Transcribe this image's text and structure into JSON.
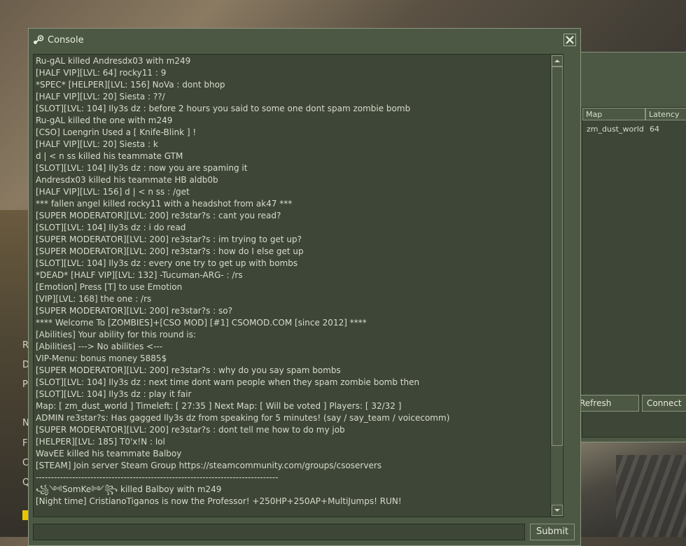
{
  "console": {
    "title": "Console",
    "submit_label": "Submit",
    "input_value": "",
    "icon": "steam-icon",
    "lines": [
      "Ru-gAL killed Andresdx03 with m249",
      "[HALF VIP][LVL: 64] rocky11 : 9",
      "*SPEC* [HELPER][LVL: 156] NoVa : dont bhop",
      "[HALF VIP][LVL: 20] Siesta : ??/",
      "[SLOT][LVL: 104] Ily3s dz : before 2 hours you said to some one dont spam zombie bomb",
      "Ru-gAL killed the one with m249",
      "[CSO] Loengrin Used a [ Knife-Blink ] !",
      "[HALF VIP][LVL: 20] Siesta : k",
      "d | < n ss killed his teammate GTM",
      "[SLOT][LVL: 104] Ily3s dz : now you are spaming it",
      "Andresdx03 killed his teammate HB aldb0b",
      "[HALF VIP][LVL: 156] d | < n ss : /get",
      "*** fallen angel killed rocky11 with a headshot from ak47 ***",
      "[SUPER MODERATOR][LVL: 200] re3star?s : cant you read?",
      "[SLOT][LVL: 104] Ily3s dz : i do read",
      "[SUPER MODERATOR][LVL: 200] re3star?s : im trying to get up?",
      "[SUPER MODERATOR][LVL: 200] re3star?s : how do I else get up",
      "[SLOT][LVL: 104] Ily3s dz : every one try to get up with bombs",
      "*DEAD* [HALF VIP][LVL: 132] -Tucuman-ARG- : /rs",
      "[Emotion] Press [T] to use Emotion",
      "[VIP][LVL: 168] the one : /rs",
      "[SUPER MODERATOR][LVL: 200] re3star?s : so?",
      "**** Welcome To [ZOMBIES]+[CSO MOD] [#1] CSOMOD.COM [since 2012] ****",
      "[Abilities] Your ability for this round is:",
      "[Abilities] ---> No abilities <---",
      "VIP-Menu: bonus money 5885$",
      "[SUPER MODERATOR][LVL: 200] re3star?s : why do you say spam bombs",
      "[SLOT][LVL: 104] Ily3s dz : next time dont warn people when they spam zombie bomb then",
      "[SLOT][LVL: 104] Ily3s dz : play it fair",
      "Map: [ zm_dust_world ] Timeleft: [ 27:35 ] Next Map: [ Will be voted ] Players: [ 32/32 ]",
      "ADMIN re3star?s: Has gagged Ily3s dz from speaking for 5 minutes! (say / say_team / voicecomm)",
      "[SUPER MODERATOR][LVL: 200] re3star?s : dont tell me how to do my job",
      "[HELPER][LVL: 185] T0'x!N : lol",
      "WavEE killed his teammate Balboy",
      "[STEAM] Join server Steam Group https://steamcommunity.com/groups/csoservers",
      "--------------------------------------------------------------------------------",
      "꧁༺SomKe༻꧂ killed Balboy with m249",
      "[Night time] CristianoTiganos is now the Professor! +250HP+250AP+MultiJumps! RUN!"
    ]
  },
  "browser": {
    "columns": [
      "Map",
      "Latency"
    ],
    "row": {
      "map": "zm_dust_world",
      "latency": "64"
    },
    "refresh_label": "Refresh",
    "connect_label": "Connect"
  },
  "background_letters": [
    "R",
    "D",
    "P",
    "N",
    "F",
    "C",
    "Q"
  ]
}
